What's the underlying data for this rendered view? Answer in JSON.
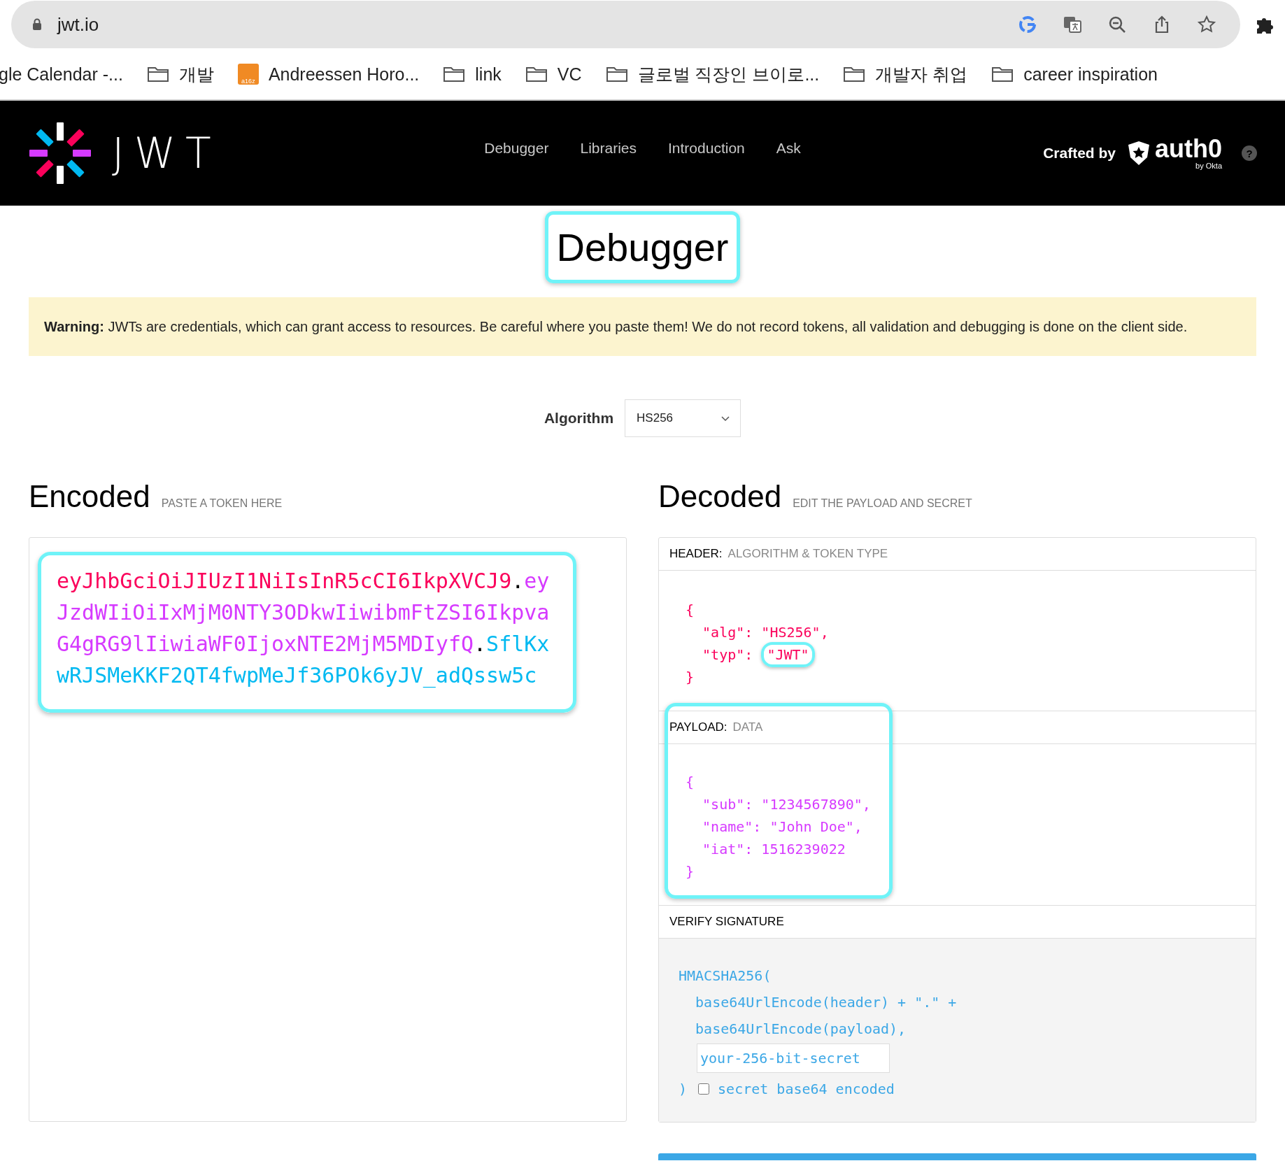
{
  "browser": {
    "url": "jwt.io",
    "bookmarks": [
      {
        "kind": "site",
        "label": "gle Calendar -..."
      },
      {
        "kind": "folder",
        "label": "개발"
      },
      {
        "kind": "favicon",
        "label": "Andreessen Horo...",
        "favicon_text": "a16z"
      },
      {
        "kind": "folder",
        "label": "link"
      },
      {
        "kind": "folder",
        "label": "VC"
      },
      {
        "kind": "folder",
        "label": "글로벌 직장인 브이로..."
      },
      {
        "kind": "folder",
        "label": "개발자 취업"
      },
      {
        "kind": "folder",
        "label": "career inspiration"
      }
    ]
  },
  "header": {
    "wordmark": "JWT",
    "nav": [
      {
        "label": "Debugger"
      },
      {
        "label": "Libraries"
      },
      {
        "label": "Introduction"
      },
      {
        "label": "Ask"
      }
    ],
    "crafted_by": "Crafted by",
    "brand": "auth0",
    "brand_sub": "by Okta",
    "help": "?"
  },
  "page_title": {
    "text": "Debugger",
    "highlighted": true
  },
  "warning": "**Warning:** JWTs are credentials, which can grant access to resources. Be careful where you paste them! We do not record tokens, all validation and debugging is done on the client side.",
  "algorithm": {
    "label": "Algorithm",
    "value": "HS256"
  },
  "encoded": {
    "title": "Encoded",
    "subtitle": "PASTE A TOKEN HERE",
    "highlighted": true,
    "token": [
      {
        "kind": "header",
        "text": "eyJhbGciOiJIUzI1NiIsInR5cCI6IkpXVCJ9"
      },
      {
        "kind": "dot",
        "text": "."
      },
      {
        "kind": "payload",
        "text": "eyJzdWIiOiIxMjM0NTY3ODkwIiwibmFtZSI6IkpvaG4gRG9lIiwiaWF0IjoxNTE2MjM5MDIyfQ"
      },
      {
        "kind": "dot",
        "text": "."
      },
      {
        "kind": "signature",
        "text": "SflKxwRJSMeKKF2QT4fwpMeJf36POk6yJV_adQssw5c"
      }
    ]
  },
  "decoded": {
    "title": "Decoded",
    "subtitle": "EDIT THE PAYLOAD AND SECRET",
    "header": {
      "label": "HEADER:",
      "sublabel": "ALGORITHM & TOKEN TYPE",
      "lines": [
        {
          "text": "{"
        },
        {
          "text": "  \"alg\": \"HS256\","
        },
        {
          "text": "  \"typ\": ",
          "highlight": "\"JWT\""
        },
        {
          "text": "}"
        }
      ]
    },
    "payload": {
      "label": "PAYLOAD:",
      "sublabel": "DATA",
      "highlighted": true,
      "lines": [
        {
          "text": "{"
        },
        {
          "text": "  \"sub\": \"1234567890\","
        },
        {
          "text": "  \"name\": \"John Doe\","
        },
        {
          "text": "  \"iat\": 1516239022"
        },
        {
          "text": "}"
        }
      ]
    },
    "verify": {
      "label": "VERIFY SIGNATURE",
      "lines": [
        "HMACSHA256(",
        "  base64UrlEncode(header) + \".\" +",
        "  base64UrlEncode(payload),"
      ],
      "secret": "your-256-bit-secret",
      "close": ")",
      "base64_checked": false,
      "base64_label": "secret base64 encoded"
    }
  }
}
